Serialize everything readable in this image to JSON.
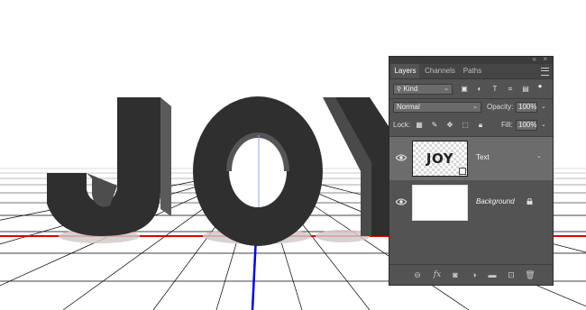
{
  "artwork": {
    "text": "JOY"
  },
  "panel": {
    "tabs": [
      {
        "label": "Layers",
        "active": true
      },
      {
        "label": "Channels",
        "active": false
      },
      {
        "label": "Paths",
        "active": false
      }
    ],
    "filter": {
      "label": "Kind"
    },
    "blend_mode": "Normal",
    "opacity_label": "Opacity:",
    "opacity_value": "100%",
    "lock_label": "Lock:",
    "fill_label": "Fill:",
    "fill_value": "100%",
    "layers": [
      {
        "name": "Text",
        "thumb_text": "JOY",
        "selected": true,
        "visible": true
      },
      {
        "name": "Background",
        "selected": false,
        "visible": true,
        "locked": true
      }
    ],
    "footer_icons": [
      "link-icon",
      "fx-icon",
      "mask-icon",
      "adjustment-icon",
      "folder-icon",
      "new-layer-icon",
      "trash-icon"
    ]
  }
}
